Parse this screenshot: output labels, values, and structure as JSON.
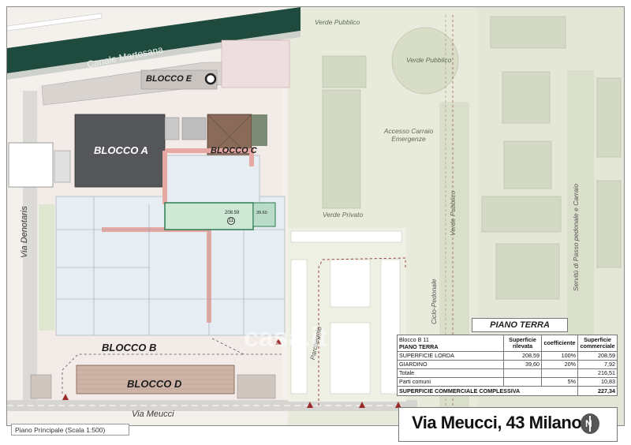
{
  "map": {
    "canal": "Canale Martesana",
    "street_denotaris": "Via Denotaris",
    "street_meucci": "Via Meucci",
    "verde_pubblico_top": "Verde Pubblico",
    "verde_pubblico_circle": "Verde Pubblico",
    "accesso_carraio": "Accesso Carraio Emergenze",
    "verde_privato": "Verde Privato",
    "verde_pubblico_vert": "Verde Pubblico",
    "parcheggio": "Parcheggio",
    "ciclopedonale": "Ciclo-Pedonale",
    "servitu": "Servitù di Passo pedonale e Carraio",
    "unit_number": "11",
    "unit_area": "208.59",
    "garden_area": "39.60",
    "watermark": "casa.it"
  },
  "blocks": {
    "a": "BLOCCO A",
    "b": "BLOCCO B",
    "c": "BLOCCO C",
    "d": "BLOCCO D",
    "e": "BLOCCO E"
  },
  "caption": "Piano Principale (Scala 1:500)",
  "panel": {
    "title": "PIANO TERRA",
    "unit": "Blocco B 11",
    "floor": "PIANO TERRA",
    "col_sup_ril": "Superficie rilevata",
    "col_coeff": "coefficiente",
    "col_sup_comm": "Superficie commerciale",
    "rows": [
      {
        "label": "SUPERFICIE LORDA",
        "ril": "208,59",
        "coeff": "100%",
        "comm": "208,59"
      },
      {
        "label": "GIARDINO",
        "ril": "39,60",
        "coeff": "20%",
        "comm": "7,92"
      }
    ],
    "totale_label": "Totale",
    "totale_value": "216,51",
    "parti_label": "Parti comuni",
    "parti_coeff": "5%",
    "parti_value": "10,83",
    "complessiva_label": "SUPERFICIE COMMERCIALE COMPLESSIVA",
    "complessiva_value": "227,34"
  },
  "address": "Via Meucci, 43 Milano",
  "north_letter": "N",
  "colors": {
    "canal": "#1f4a3e",
    "roof_dark": "#54565a",
    "roof_brown": "#8a6a58",
    "green_area": "#dfe6cf",
    "unit_highlight": "#b9dcc8",
    "accent_red": "#9b2b2b"
  }
}
